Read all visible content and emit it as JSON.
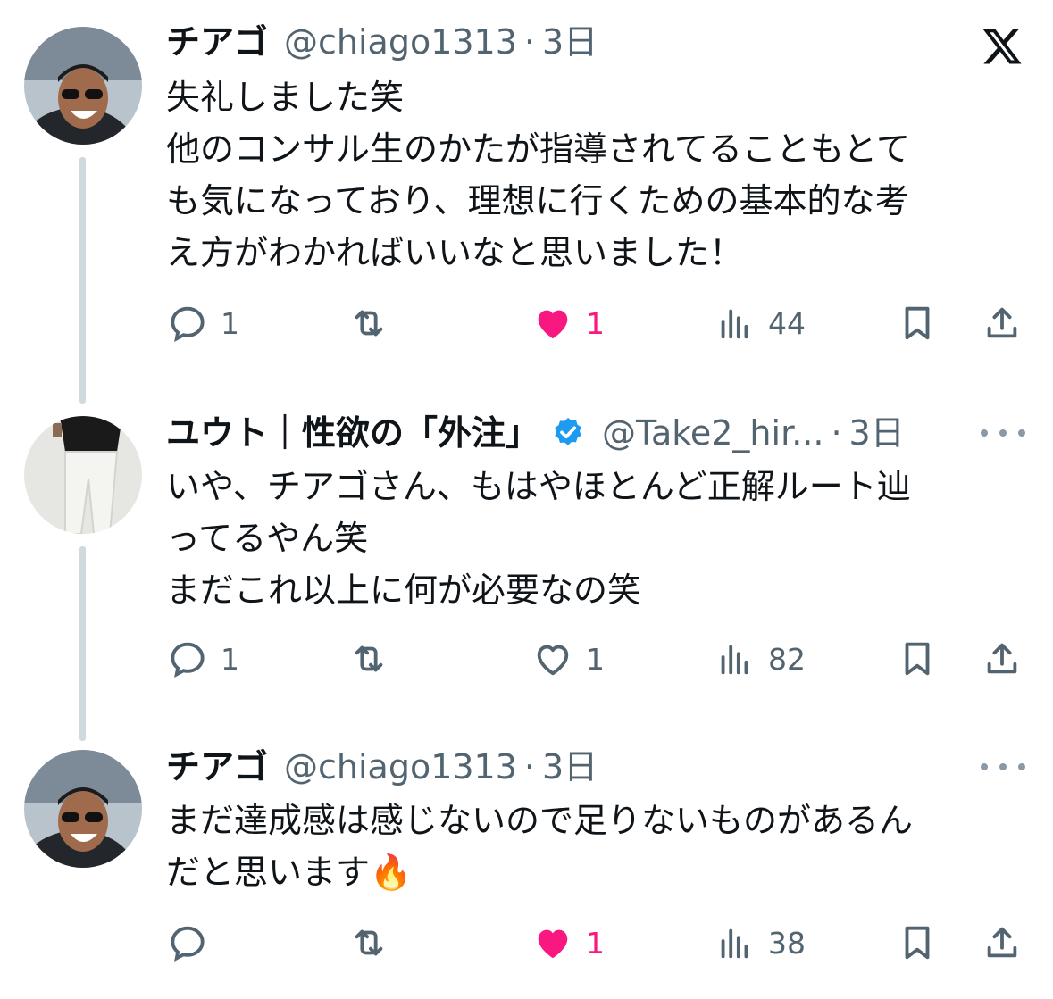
{
  "app": {
    "logo": "x-logo-icon"
  },
  "tweets": [
    {
      "name": "チアゴ",
      "handle": "@chiago1313",
      "separator": "·",
      "time": "3日",
      "lines": [
        "失礼しました笑",
        "他のコンサル生のかたが指導されてることもとて",
        "も気になっており、理想に行くための基本的な考",
        "え方がわかればいいなと思いました！"
      ],
      "replies": "1",
      "retweets": "",
      "likes": "1",
      "liked": true,
      "views": "44"
    },
    {
      "name": "ユウト｜性欲の「外注」",
      "verified": true,
      "handle": "@Take2_hir...",
      "separator": "·",
      "time": "3日",
      "lines": [
        "いや、チアゴさん、もはやほとんど正解ルート辿",
        "ってるやん笑",
        "まだこれ以上に何が必要なの笑"
      ],
      "replies": "1",
      "retweets": "",
      "likes": "1",
      "liked": false,
      "views": "82"
    },
    {
      "name": "チアゴ",
      "handle": "@chiago1313",
      "separator": "·",
      "time": "3日",
      "lines": [
        "まだ達成感は感じないので足りないものがあるん",
        "だと思います"
      ],
      "emoji": "🔥",
      "replies": "",
      "retweets": "",
      "likes": "1",
      "liked": true,
      "views": "38"
    }
  ],
  "colors": {
    "text": "#0f1419",
    "secondary": "#536471",
    "like": "#f91880",
    "verified": "#1d9bf0",
    "thread_line": "#cfd9de"
  }
}
